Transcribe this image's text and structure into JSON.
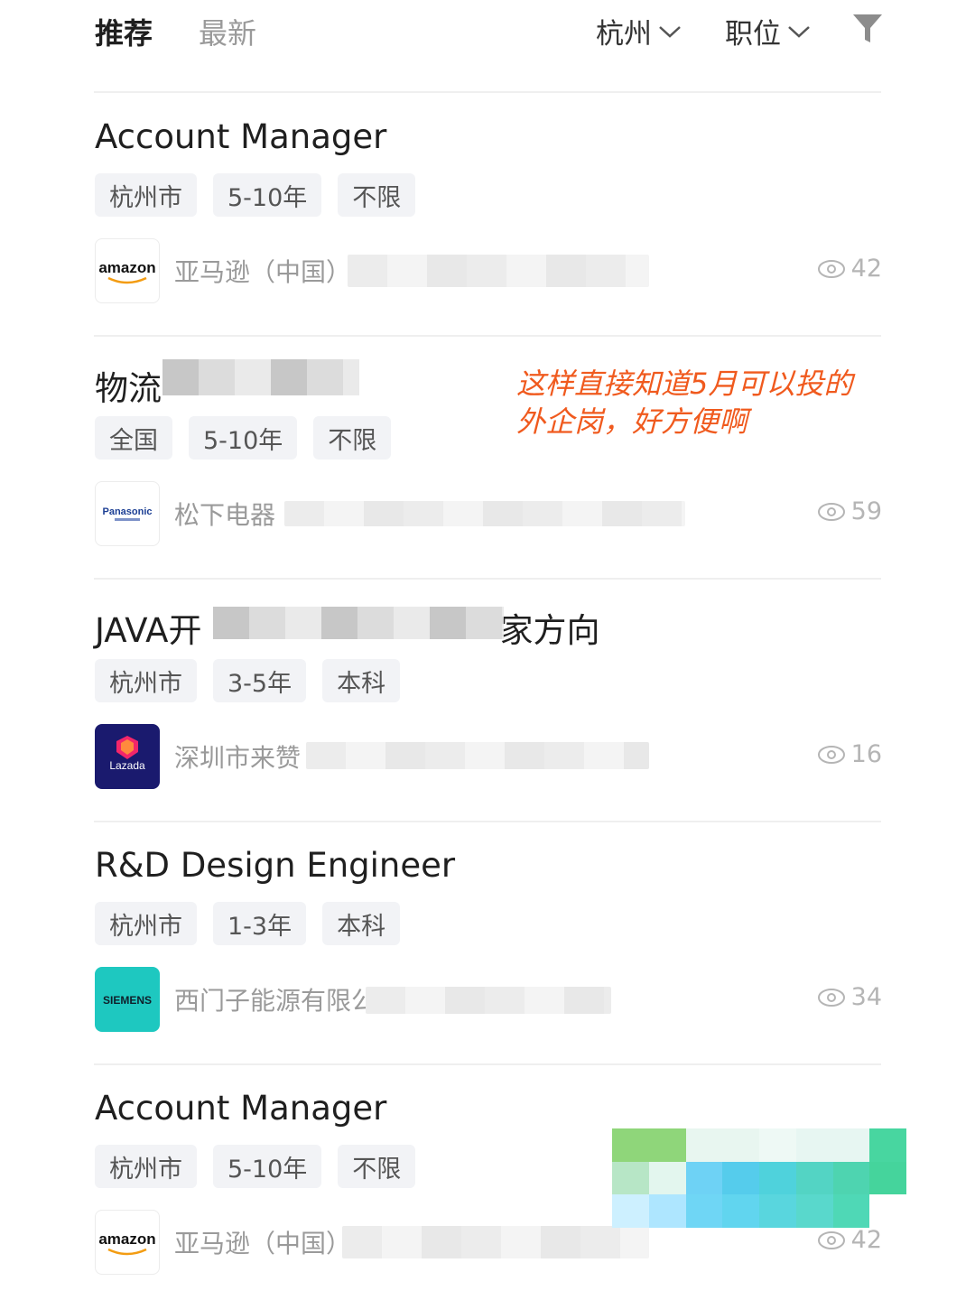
{
  "tabs": {
    "recommended": "推荐",
    "latest": "最新"
  },
  "filters": {
    "city": "杭州",
    "position": "职位"
  },
  "annotation": {
    "line1": "这样直接知道5月可以投的",
    "line2": "外企岗，好方便啊"
  },
  "jobs": [
    {
      "title": "Account Manager",
      "tags": [
        "杭州市",
        "5-10年",
        "不限"
      ],
      "company": "亚马逊（中国）",
      "views": "42",
      "logo": "amazon"
    },
    {
      "title": "物流",
      "tags": [
        "全国",
        "5-10年",
        "不限"
      ],
      "company": "松下电器",
      "views": "59",
      "logo": "Panasonic"
    },
    {
      "title": "JAVA开",
      "title_tail": "家方向",
      "tags": [
        "杭州市",
        "3-5年",
        "本科"
      ],
      "company": "深圳市来赞",
      "views": "16",
      "logo": "Lazada"
    },
    {
      "title": "R&D Design Engineer",
      "tags": [
        "杭州市",
        "1-3年",
        "本科"
      ],
      "company": "西门子能源有限公",
      "views": "34",
      "logo": "SIEMENS"
    },
    {
      "title": "Account Manager",
      "tags": [
        "杭州市",
        "5-10年",
        "不限"
      ],
      "company": "亚马逊（中国）",
      "views": "42",
      "logo": "amazon"
    }
  ],
  "colors": {
    "annotation": "#f05a1e",
    "tag_bg": "#f2f3f6",
    "siemens": "#1ec8c0",
    "lazada": "#1a1a6e"
  }
}
